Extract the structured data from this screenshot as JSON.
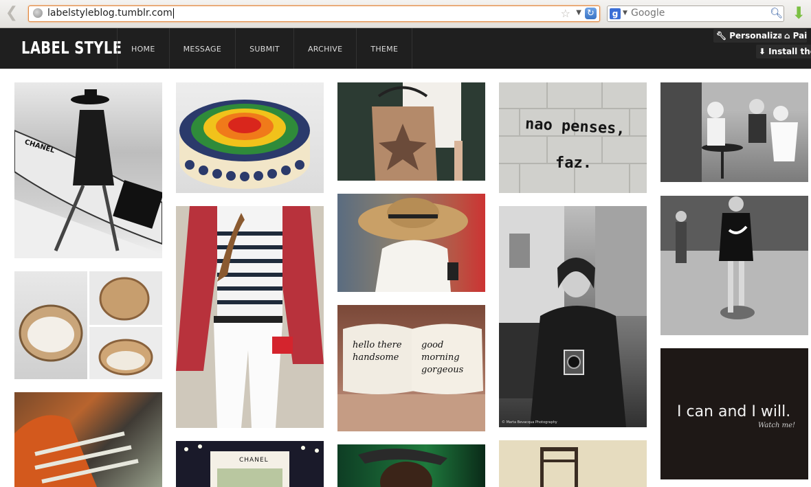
{
  "browser": {
    "url": "labelstyleblog.tumblr.com",
    "search_placeholder": "Google",
    "search_engine_glyph": "g",
    "icons": {
      "back": "back-arrow-icon",
      "bookmark": "star-icon",
      "reload": "reload-icon",
      "search": "magnifier-icon",
      "download": "download-arrow-icon"
    }
  },
  "site": {
    "logo": "LABEL STYLE",
    "nav": [
      "HOME",
      "MESSAGE",
      "SUBMIT",
      "ARCHIVE",
      "THEME"
    ]
  },
  "tumblr_controls": {
    "customize": "Personalizar",
    "follow": "Pai",
    "install": "Install ther"
  },
  "posts": {
    "graffiti_line1": "nao penses,",
    "graffiti_line2": "faz.",
    "pillow_left": "hello there handsome",
    "pillow_right": "good morning gorgeous",
    "surfboard_brand": "CHANEL",
    "stand_sign": "CHANEL",
    "quote": "I can and I will.",
    "quote_sub": "Watch me!",
    "photo_credit": "© Marta Bevacqua Photography"
  },
  "colors": {
    "header_bg": "#1f1f1f",
    "url_focus": "#e2853a",
    "page_bg": "#ffffff"
  }
}
